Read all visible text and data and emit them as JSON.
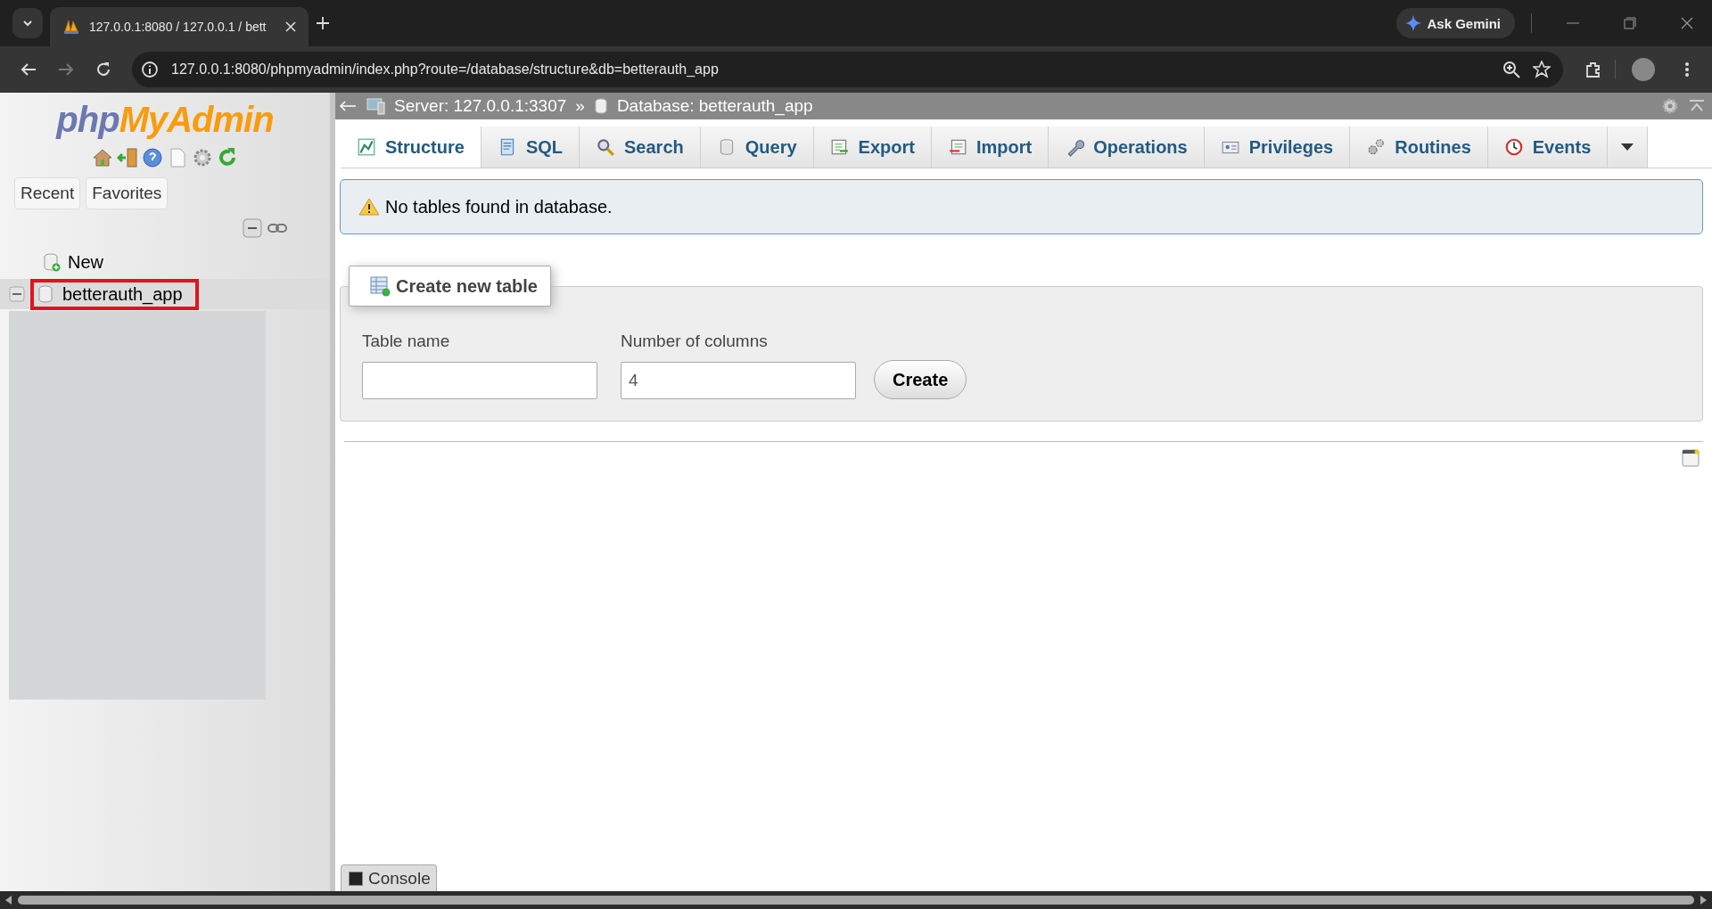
{
  "browser": {
    "tabs": [
      {
        "title": "127.0.0.1:8080 / 127.0.0.1 / bett",
        "selected": true
      }
    ],
    "url": "127.0.0.1:8080/phpmyadmin/index.php?route=/database/structure&db=betterauth_app",
    "gemini_label": "Ask Gemini"
  },
  "sidebar": {
    "logo_php": "php",
    "logo_rest": "MyAdmin",
    "buttons": [
      {
        "label": "Recent"
      },
      {
        "label": "Favorites"
      }
    ],
    "tree": [
      {
        "label": "New",
        "kind": "new",
        "highlighted": false
      },
      {
        "label": "betterauth_app",
        "kind": "database",
        "highlighted": true
      }
    ]
  },
  "breadcrumb": {
    "server": "Server: 127.0.0.1:3307",
    "separator": "»",
    "database": "Database: betterauth_app"
  },
  "tabs": [
    {
      "label": "Structure",
      "kind": "structure",
      "selected": true
    },
    {
      "label": "SQL",
      "kind": "sql",
      "selected": false
    },
    {
      "label": "Search",
      "kind": "search",
      "selected": false
    },
    {
      "label": "Query",
      "kind": "query",
      "selected": false
    },
    {
      "label": "Export",
      "kind": "export",
      "selected": false
    },
    {
      "label": "Import",
      "kind": "import",
      "selected": false
    },
    {
      "label": "Operations",
      "kind": "operations",
      "selected": false
    },
    {
      "label": "Privileges",
      "kind": "privileges",
      "selected": false
    },
    {
      "label": "Routines",
      "kind": "routines",
      "selected": false
    },
    {
      "label": "Events",
      "kind": "events",
      "selected": false
    }
  ],
  "message": "No tables found in database.",
  "create_table": {
    "legend": "Create new table",
    "fields": [
      {
        "label": "Table name"
      },
      {
        "label": "Number of columns",
        "value": "4"
      }
    ],
    "button": "Create"
  },
  "console": "Console"
}
